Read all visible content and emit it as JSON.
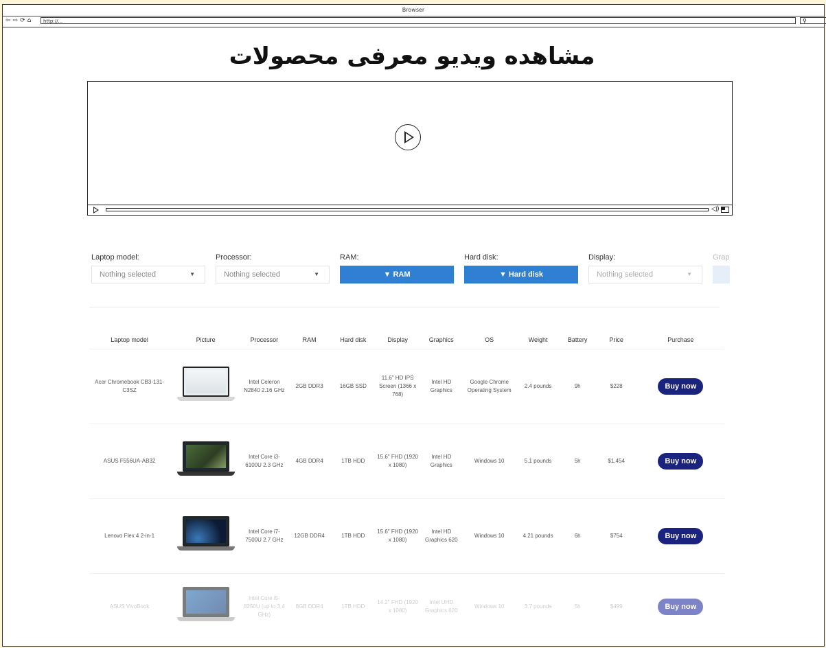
{
  "browser": {
    "title": "Browser",
    "url": "http://...",
    "search_icon": "search-icon"
  },
  "page": {
    "title": "مشاهده ویدیو معرفی محصولات"
  },
  "video": {
    "play_icon": "play-icon",
    "volume_icon": "speaker-icon",
    "fullscreen_icon": "fullscreen-icon"
  },
  "filters": [
    {
      "label": "Laptop model:",
      "type": "select",
      "value": "Nothing selected"
    },
    {
      "label": "Processor:",
      "type": "select",
      "value": "Nothing selected"
    },
    {
      "label": "RAM:",
      "type": "button",
      "value": "RAM"
    },
    {
      "label": "Hard disk:",
      "type": "button",
      "value": "Hard disk"
    },
    {
      "label": "Display:",
      "type": "select",
      "value": "Nothing selected"
    },
    {
      "label": "Graphics:",
      "type": "button",
      "value": ""
    }
  ],
  "filter_icon": "funnel-icon",
  "table": {
    "headers": [
      "Laptop model",
      "Picture",
      "Processor",
      "RAM",
      "Hard disk",
      "Display",
      "Graphics",
      "OS",
      "Weight",
      "Battery",
      "Price",
      "Purchase"
    ],
    "rows": [
      {
        "model": "Acer Chromebook CB3-131-C3SZ",
        "processor": "Intel Celeron N2840 2.16 GHz",
        "ram": "2GB DDR3",
        "disk": "16GB SSD",
        "display": "11.6\" HD IPS Screen (1366 x 768)",
        "graphics": "Intel HD Graphics",
        "os": "Google Chrome Operating System",
        "weight": "2.4 pounds",
        "battery": "9h",
        "price": "$228",
        "buy": "Buy now"
      },
      {
        "model": "ASUS F556UA-AB32",
        "processor": "Intel Core i3-6100U 2.3 GHz",
        "ram": "4GB DDR4",
        "disk": "1TB HDD",
        "display": "15.6\" FHD (1920 x 1080)",
        "graphics": "Intel HD Graphics",
        "os": "Windows 10",
        "weight": "5.1 pounds",
        "battery": "5h",
        "price": "$1,454",
        "buy": "Buy now"
      },
      {
        "model": "Lenovo Flex 4 2-in-1",
        "processor": "Intel Core i7-7500U 2.7 GHz",
        "ram": "12GB DDR4",
        "disk": "1TB HDD",
        "display": "15.6\" FHD (1920 x 1080)",
        "graphics": "Intel HD Graphics 620",
        "os": "Windows 10",
        "weight": "4.21 pounds",
        "battery": "6h",
        "price": "$754",
        "buy": "Buy now"
      },
      {
        "model": "ASUS VivoBook",
        "processor": "Intel Core i5-8250U (up to 3.4 GHz)",
        "ram": "8GB DDR4",
        "disk": "1TB HDD",
        "display": "14.2\" FHD (1920 x 1080)",
        "graphics": "Intel UHD Graphics 620",
        "os": "Windows 10",
        "weight": "3.7 pounds",
        "battery": "5h",
        "price": "$499",
        "buy": "Buy now"
      }
    ]
  },
  "colors": {
    "filter_button": "#2f7fd3",
    "buy_button": "#1a237e"
  }
}
